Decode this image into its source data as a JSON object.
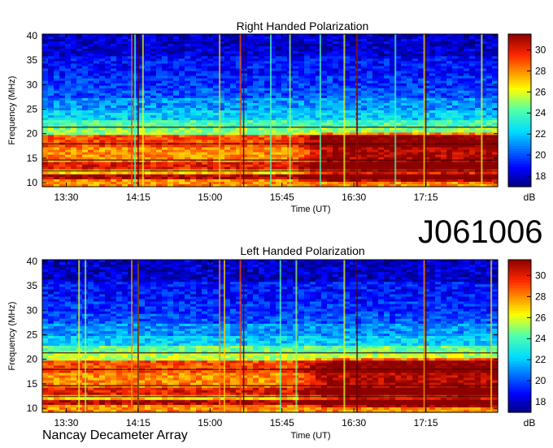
{
  "observation_id": "J061006",
  "footer_text": "Nancay Decameter Array",
  "colorbar": {
    "unit": "dB",
    "ticks": [
      18,
      20,
      22,
      24,
      26,
      28,
      30
    ],
    "range": [
      17,
      31.5
    ]
  },
  "chart_data": [
    {
      "type": "heatmap",
      "title": "Right Handed Polarization",
      "xlabel": "Time (UT)",
      "ylabel": "Frequency (MHz)",
      "x_ticks": [
        "13:30",
        "14:15",
        "15:00",
        "15:45",
        "16:30",
        "17:15"
      ],
      "x_tick_minutes": [
        810,
        855,
        900,
        945,
        990,
        1035
      ],
      "xlim_minutes": [
        795,
        1080
      ],
      "y_ticks": [
        10,
        15,
        20,
        25,
        30,
        35,
        40
      ],
      "ylim": [
        9.2,
        40.3
      ],
      "value_unit": "dB",
      "bands": [
        {
          "f": [
            9.2,
            10.5
          ],
          "db": 28
        },
        {
          "f": [
            10.5,
            11.5
          ],
          "db": 31
        },
        {
          "f": [
            11.5,
            12.5
          ],
          "db": 27
        },
        {
          "f": [
            12.5,
            14
          ],
          "db": 30
        },
        {
          "f": [
            14,
            17
          ],
          "db": 28
        },
        {
          "f": [
            17,
            19.5
          ],
          "db": 29
        },
        {
          "f": [
            19.5,
            21
          ],
          "db": 25
        },
        {
          "f": [
            21,
            22.5
          ],
          "db": 24
        },
        {
          "f": [
            22.5,
            25
          ],
          "db": 22
        },
        {
          "f": [
            25,
            27.5
          ],
          "db": 21
        },
        {
          "f": [
            27.5,
            29.5
          ],
          "db": 20
        },
        {
          "f": [
            29.5,
            32
          ],
          "db": 19.5
        },
        {
          "f": [
            32,
            36
          ],
          "db": 19
        },
        {
          "f": [
            36,
            40.3
          ],
          "db": 18
        }
      ],
      "late_enhancement": {
        "from_minute": 950,
        "f": [
          10,
          20
        ],
        "extra_db": 3
      },
      "spikes": [
        {
          "t": 851,
          "db": 29
        },
        {
          "t": 853,
          "db": 24
        },
        {
          "t": 858,
          "db": 26
        },
        {
          "t": 906,
          "db": 27
        },
        {
          "t": 919,
          "db": 29
        },
        {
          "t": 938,
          "db": 24
        },
        {
          "t": 950,
          "db": 25
        },
        {
          "t": 969,
          "db": 24
        },
        {
          "t": 984,
          "db": 26
        },
        {
          "t": 992,
          "db": 29
        },
        {
          "t": 1016,
          "db": 24
        },
        {
          "t": 1034,
          "db": 27
        },
        {
          "t": 1070,
          "db": 26
        }
      ],
      "gap_lines_minutes": [
        855,
        921,
        992,
        1035
      ],
      "dark_rows_mhz": [
        12.4,
        14.6,
        17.9,
        21.3
      ]
    },
    {
      "type": "heatmap",
      "title": "Left Handed Polarization",
      "xlabel": "Time (UT)",
      "ylabel": "Frequency (MHz)",
      "x_ticks": [
        "13:30",
        "14:15",
        "15:00",
        "15:45",
        "16:30",
        "17:15"
      ],
      "x_tick_minutes": [
        810,
        855,
        900,
        945,
        990,
        1035
      ],
      "xlim_minutes": [
        795,
        1080
      ],
      "y_ticks": [
        10,
        15,
        20,
        25,
        30,
        35,
        40
      ],
      "ylim": [
        9.2,
        40.3
      ],
      "value_unit": "dB",
      "bands": [
        {
          "f": [
            9.2,
            10.5
          ],
          "db": 28
        },
        {
          "f": [
            10.5,
            11.5
          ],
          "db": 31
        },
        {
          "f": [
            11.5,
            12.5
          ],
          "db": 27
        },
        {
          "f": [
            12.5,
            14
          ],
          "db": 30
        },
        {
          "f": [
            14,
            17
          ],
          "db": 28
        },
        {
          "f": [
            17,
            19.5
          ],
          "db": 29
        },
        {
          "f": [
            19.5,
            21
          ],
          "db": 25.5
        },
        {
          "f": [
            21,
            22.5
          ],
          "db": 24.5
        },
        {
          "f": [
            22.5,
            25
          ],
          "db": 22
        },
        {
          "f": [
            25,
            27.5
          ],
          "db": 21
        },
        {
          "f": [
            27.5,
            29.5
          ],
          "db": 20
        },
        {
          "f": [
            29.5,
            32
          ],
          "db": 19.5
        },
        {
          "f": [
            32,
            36
          ],
          "db": 19
        },
        {
          "f": [
            36,
            40.3
          ],
          "db": 18
        }
      ],
      "late_enhancement": {
        "from_minute": 950,
        "f": [
          10,
          20
        ],
        "extra_db": 3
      },
      "spikes": [
        {
          "t": 818,
          "db": 26
        },
        {
          "t": 822,
          "db": 25
        },
        {
          "t": 851,
          "db": 28
        },
        {
          "t": 855,
          "db": 26
        },
        {
          "t": 906,
          "db": 28
        },
        {
          "t": 909,
          "db": 27
        },
        {
          "t": 919,
          "db": 29
        },
        {
          "t": 944,
          "db": 24
        },
        {
          "t": 954,
          "db": 25
        },
        {
          "t": 984,
          "db": 26
        },
        {
          "t": 1034,
          "db": 28
        },
        {
          "t": 1076,
          "db": 27
        }
      ],
      "gap_lines_minutes": [
        855,
        921,
        992,
        1035
      ],
      "dark_rows_mhz": [
        12.4,
        14.6,
        17.9,
        21.3
      ]
    }
  ]
}
